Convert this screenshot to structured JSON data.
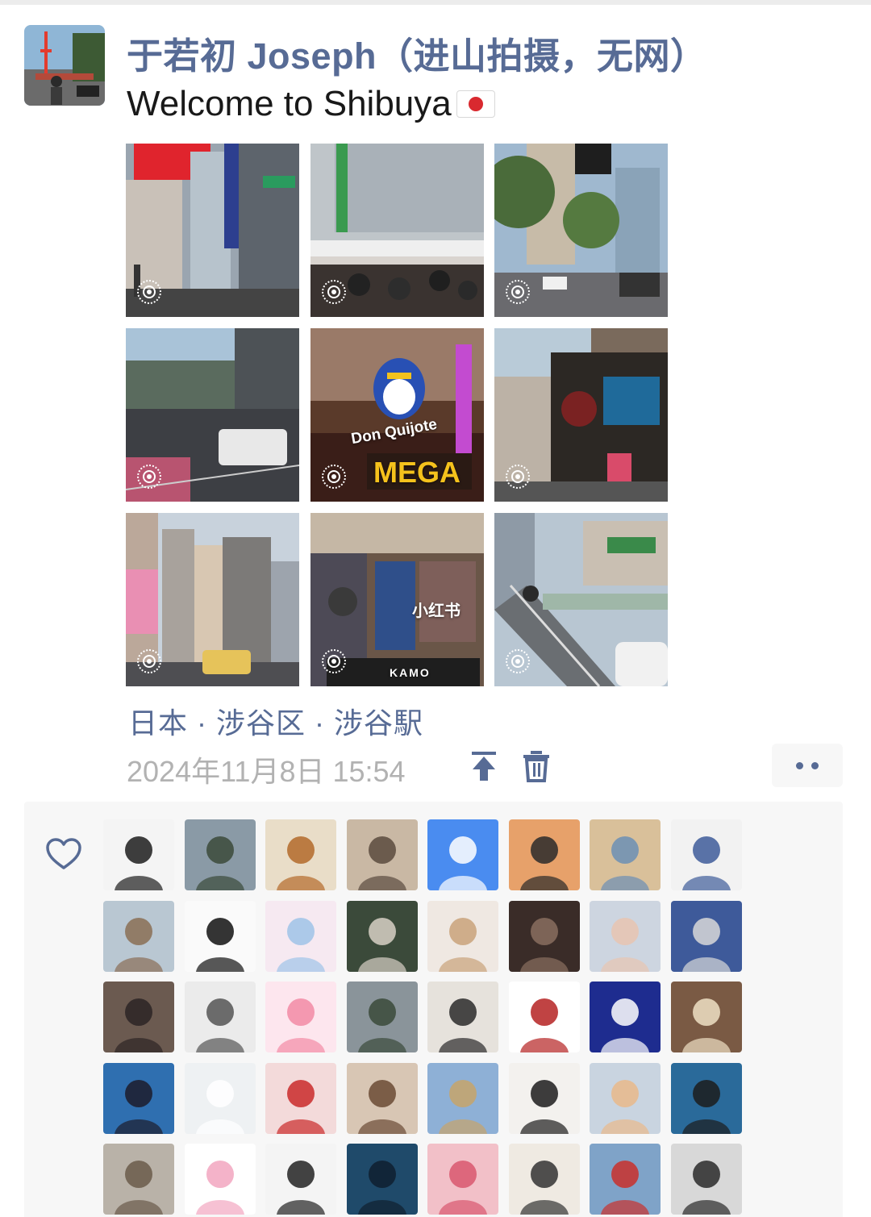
{
  "post": {
    "author": "于若初 Joseph（进山拍摄，无网）",
    "text": "Welcome to Shibuya",
    "flag_icon": "japan-flag-icon",
    "location": "日本 · 涉谷区 · 涉谷駅",
    "timestamp": "2024年11月8日 15:54",
    "photos": [
      {
        "scene": "shibuya-street-billboards",
        "live": true
      },
      {
        "scene": "shibuya-station-crowd",
        "live": true
      },
      {
        "scene": "city-traffic-trees",
        "live": true
      },
      {
        "scene": "overpass-road-van",
        "live": true
      },
      {
        "scene": "don-quijote-mega",
        "live": true,
        "overlay": "Don Quijote",
        "overlay2": "MEGA"
      },
      {
        "scene": "storefront-street",
        "live": true
      },
      {
        "scene": "narrow-street-buildings",
        "live": true
      },
      {
        "scene": "clothing-store-interior",
        "live": true,
        "overlay": "小红书",
        "overlay2": "KAMO"
      },
      {
        "scene": "pedestrian-bridge-stairs",
        "live": true
      }
    ],
    "actions": {
      "pin_icon": "pin-to-top-icon",
      "delete_icon": "trash-icon",
      "more_icon": "more-dots-icon"
    }
  },
  "likes": {
    "heart_icon": "heart-outline-icon",
    "avatar_count_visible": 40
  },
  "colors": {
    "link_blue": "#576b95",
    "timestamp_gray": "#b2b2b2",
    "panel_bg": "#f7f7f7",
    "text_black": "#191919"
  }
}
